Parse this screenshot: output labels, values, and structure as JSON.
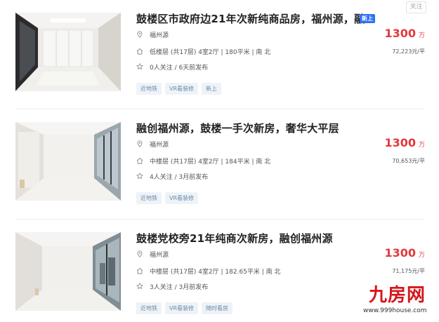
{
  "follow_label": "关注",
  "listings": [
    {
      "title": "鼓楼区市政府边21年次新纯商品房，福州源，融...",
      "badge": "新上",
      "community": "福州源",
      "info": "低楼层 (共17层) 4室2厅 | 180平米 | 南 北",
      "meta": "0人关注 / 6天前发布",
      "tags": [
        "近地铁",
        "VR看装修",
        "新上"
      ],
      "price": "1300",
      "price_unit": "万",
      "unit_price": "72,223元/平"
    },
    {
      "title": "融创福州源，鼓楼一手次新房，奢华大平层",
      "badge": "",
      "community": "福州源",
      "info": "中楼层 (共17层) 4室2厅 | 184平米 | 南 北",
      "meta": "4人关注 / 3月前发布",
      "tags": [
        "近地铁",
        "VR看装修"
      ],
      "price": "1300",
      "price_unit": "万",
      "unit_price": "70,653元/平"
    },
    {
      "title": "鼓楼党校旁21年纯商次新房，融创福州源",
      "badge": "",
      "community": "福州源",
      "info": "中楼层 (共17层) 4室2厅 | 182.65平米 | 南 北",
      "meta": "3人关注 / 3月前发布",
      "tags": [
        "近地铁",
        "VR看装修",
        "随时看房"
      ],
      "price": "1300",
      "price_unit": "万",
      "unit_price": "71,175元/平"
    }
  ],
  "watermark": {
    "brand": "九房网",
    "url": "www.999house.com"
  },
  "icons": {
    "location": "map-pin-icon",
    "house": "house-icon",
    "star": "star-icon"
  },
  "colors": {
    "price": "#e4393c",
    "badge": "#3072f6",
    "tag_text": "#6a8aa8",
    "tag_bg": "#eef3f8",
    "logo": "#d6151b"
  }
}
